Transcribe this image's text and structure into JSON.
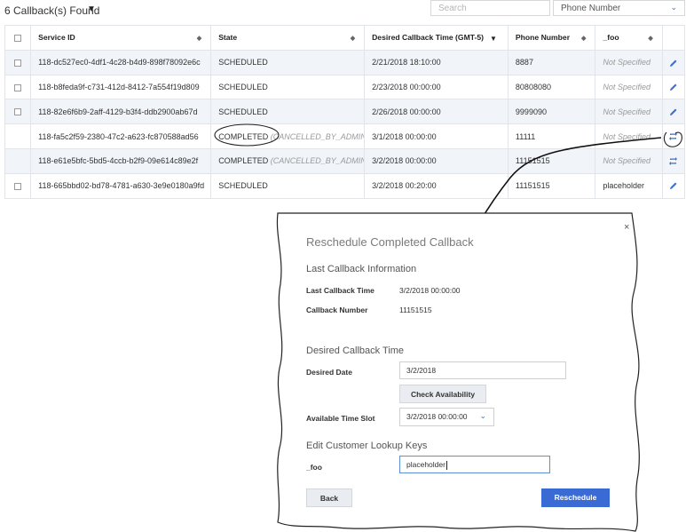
{
  "header": {
    "found_label": "6 Callback(s) Found",
    "search_placeholder": "Search",
    "filter_value": "Phone Number"
  },
  "table": {
    "columns": [
      "Service ID",
      "State",
      "Desired Callback Time (GMT-5)",
      "Phone Number",
      "_foo"
    ],
    "rows": [
      {
        "id": "118-dc527ec0-4df1-4c28-b4d9-898f78092e6c",
        "state": "SCHEDULED",
        "state_note": "",
        "time": "2/21/2018 18:10:00",
        "phone": "8887",
        "foo": "Not Specified",
        "action": "pencil-icon",
        "has_checkbox": true
      },
      {
        "id": "118-b8feda9f-c731-412d-8412-7a554f19d809",
        "state": "SCHEDULED",
        "state_note": "",
        "time": "2/23/2018 00:00:00",
        "phone": "80808080",
        "foo": "Not Specified",
        "action": "pencil-icon",
        "has_checkbox": true
      },
      {
        "id": "118-82e6f6b9-2aff-4129-b3f4-ddb2900ab67d",
        "state": "SCHEDULED",
        "state_note": "",
        "time": "2/26/2018 00:00:00",
        "phone": "9999090",
        "foo": "Not Specified",
        "action": "pencil-icon",
        "has_checkbox": true
      },
      {
        "id": "118-fa5c2f59-2380-47c2-a623-fc870588ad56",
        "state": "COMPLETED",
        "state_note": "(CANCELLED_BY_ADMIN)",
        "time": "3/1/2018 00:00:00",
        "phone": "11111",
        "foo": "Not Specified",
        "action": "reschedule-icon",
        "has_checkbox": false
      },
      {
        "id": "118-e61e5bfc-5bd5-4ccb-b2f9-09e614c89e2f",
        "state": "COMPLETED",
        "state_note": "(CANCELLED_BY_ADMIN)",
        "time": "3/2/2018 00:00:00",
        "phone": "11151515",
        "foo": "Not Specified",
        "action": "reschedule-icon",
        "has_checkbox": false
      },
      {
        "id": "118-665bbd02-bd78-4781-a630-3e9e0180a9fd",
        "state": "SCHEDULED",
        "state_note": "",
        "time": "3/2/2018 00:20:00",
        "phone": "11151515",
        "foo": "placeholder",
        "action": "pencil-icon",
        "has_checkbox": true
      }
    ]
  },
  "dialog": {
    "title": "Reschedule Completed Callback",
    "close_glyph": "×",
    "last_section": "Last Callback Information",
    "last_time_label": "Last Callback Time",
    "last_time_value": "3/2/2018 00:00:00",
    "last_number_label": "Callback Number",
    "last_number_value": "11151515",
    "desired_section": "Desired Callback Time",
    "desired_date_label": "Desired Date",
    "desired_date_value": "3/2/2018",
    "check_label": "Check Availability",
    "slot_label": "Available Time Slot",
    "slot_value": "3/2/2018 00:00:00",
    "keys_section": "Edit Customer Lookup Keys",
    "foo_label": "_foo",
    "foo_value": "placeholder",
    "back_label": "Back",
    "reschedule_label": "Reschedule"
  },
  "colors": {
    "accent": "#3b6fd0",
    "primary_button": "#3a6bd4",
    "row_shade": "#f1f4f9"
  }
}
